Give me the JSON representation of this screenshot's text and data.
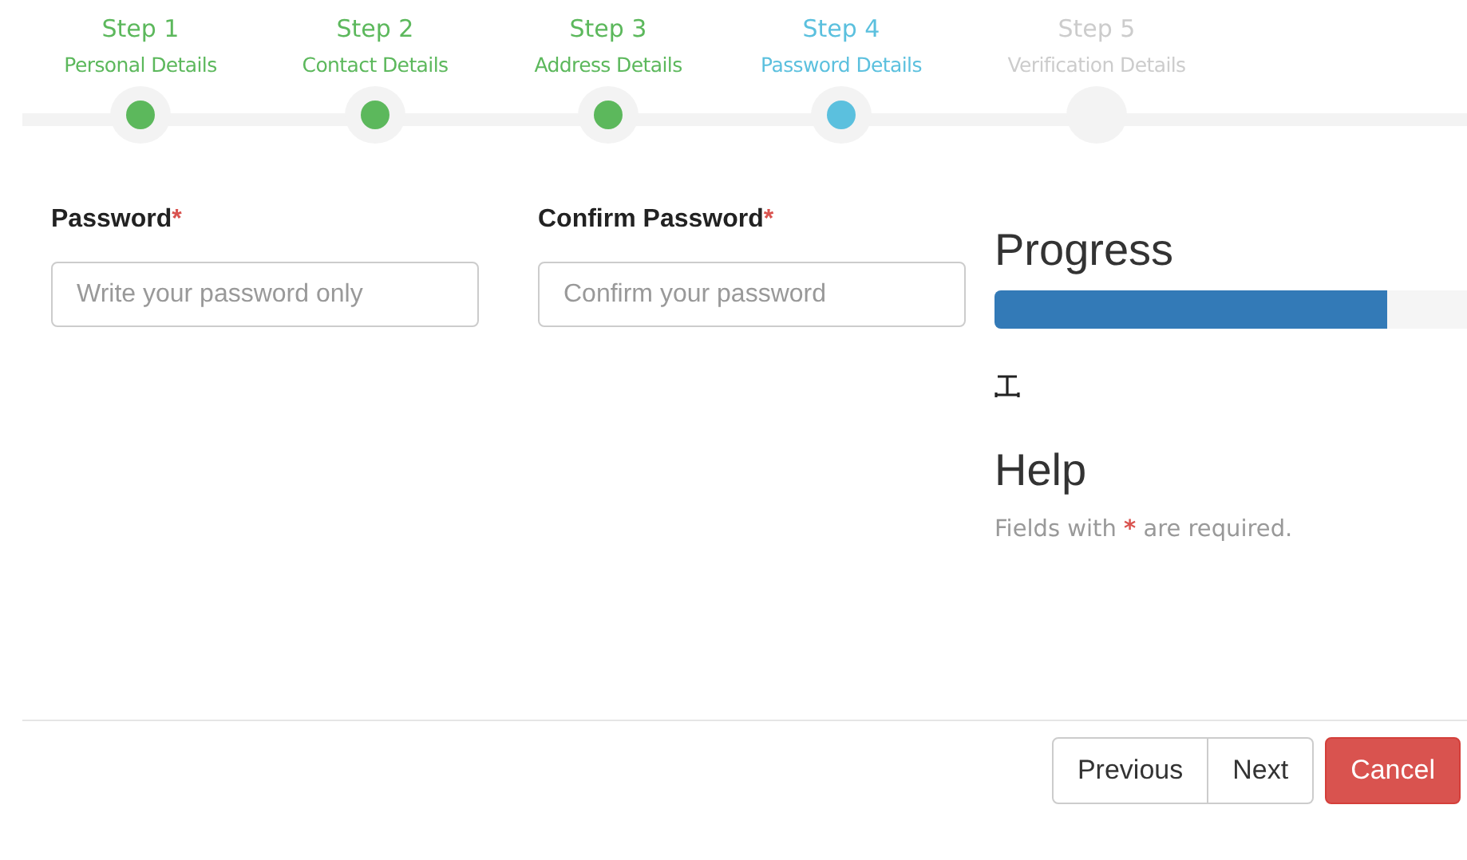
{
  "steps": [
    {
      "number": "Step 1",
      "label": "Personal Details",
      "completed": true,
      "selected": false
    },
    {
      "number": "Step 2",
      "label": "Contact Details",
      "completed": true,
      "selected": false
    },
    {
      "number": "Step 3",
      "label": "Address Details",
      "completed": true,
      "selected": false
    },
    {
      "number": "Step 4",
      "label": "Password Details",
      "completed": false,
      "selected": true
    },
    {
      "number": "Step 5",
      "label": "Verification Details",
      "completed": false,
      "selected": false
    }
  ],
  "fields": [
    {
      "label": "Password",
      "required_mark": "*",
      "placeholder": "Write your password only"
    },
    {
      "label": "Confirm Password",
      "required_mark": "*",
      "placeholder": "Confirm your password"
    }
  ],
  "progress": {
    "title": "Progress",
    "level": 0.83
  },
  "help": {
    "title": "Help",
    "text_before": "Fields with",
    "required_mark": "*",
    "text_after": "are required."
  },
  "buttons": [
    {
      "label": "Previous",
      "kind": "default"
    },
    {
      "label": "Next",
      "kind": "default"
    },
    {
      "label": "Cancel",
      "kind": "danger"
    }
  ]
}
